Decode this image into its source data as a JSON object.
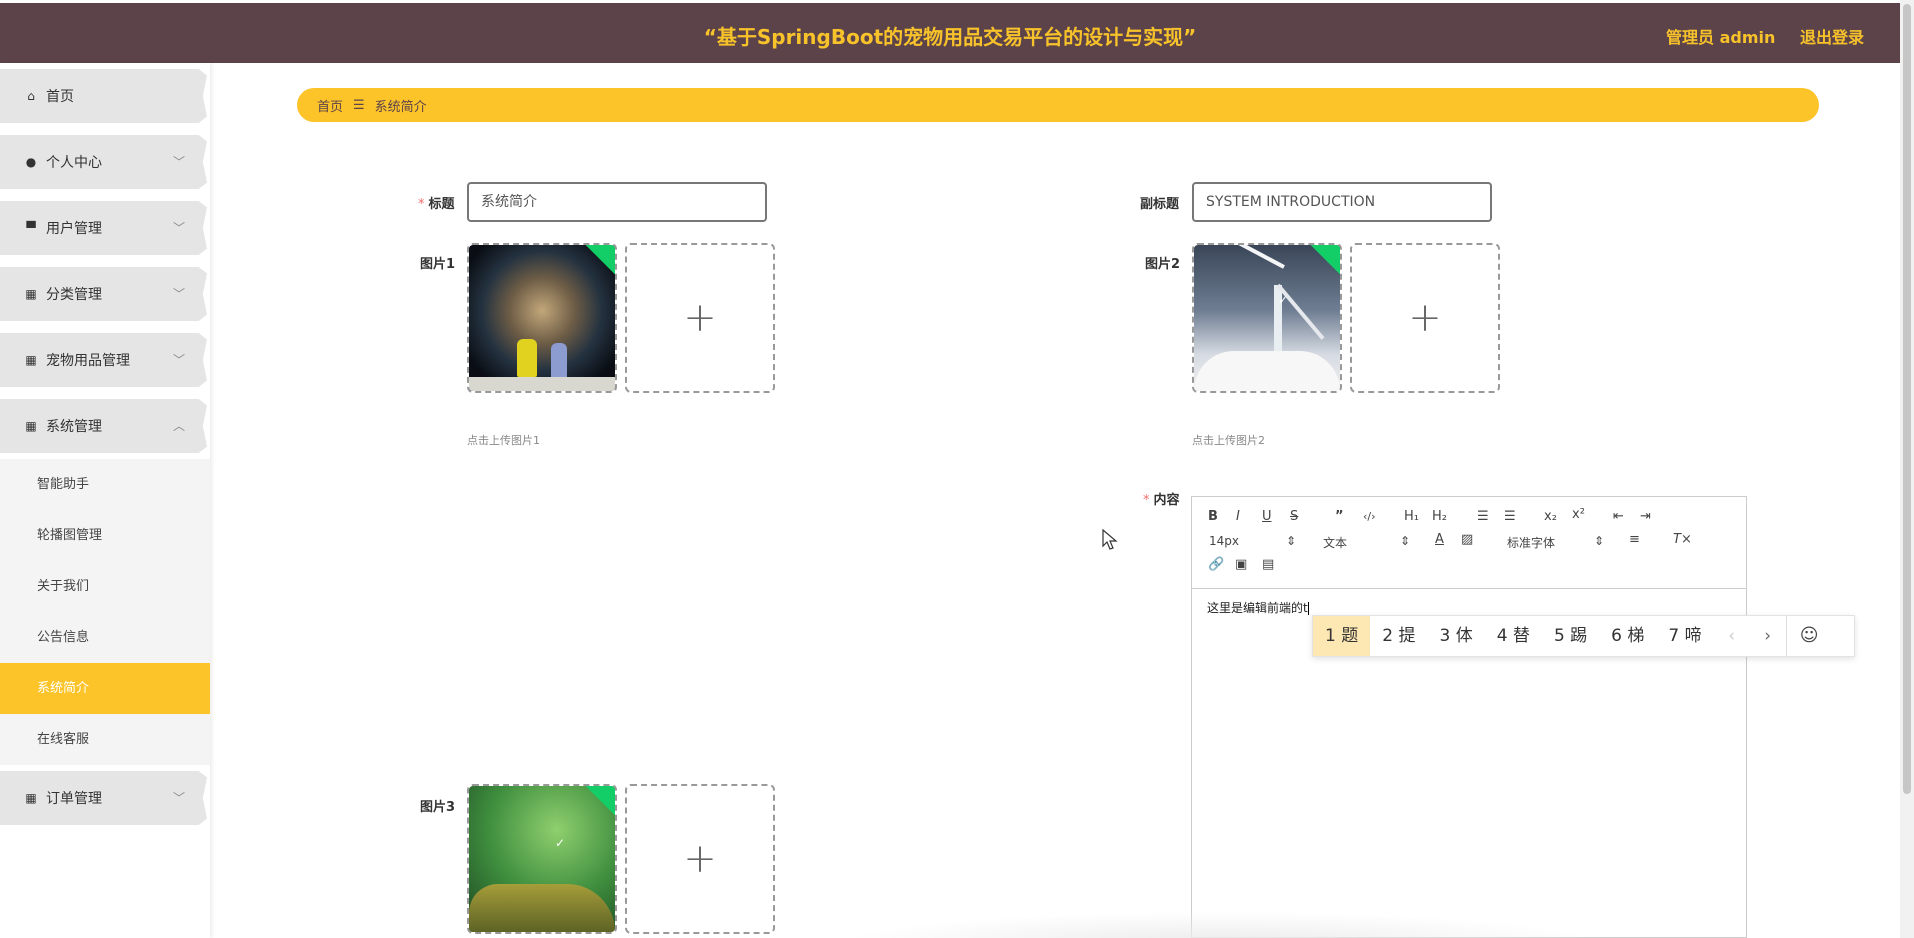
{
  "header": {
    "title": "“基于SpringBoot的宠物用品交易平台的设计与实现”",
    "user": "管理员 admin",
    "logout": "退出登录"
  },
  "sidebar": {
    "items": [
      {
        "label": "首页",
        "icon": "home-icon"
      },
      {
        "label": "个人中心",
        "icon": "user-icon"
      },
      {
        "label": "用户管理",
        "icon": "pin-icon"
      },
      {
        "label": "分类管理",
        "icon": "grid-icon"
      },
      {
        "label": "宠物用品管理",
        "icon": "grid-icon"
      },
      {
        "label": "系统管理",
        "icon": "grid-icon"
      },
      {
        "label": "订单管理",
        "icon": "grid-icon"
      }
    ],
    "submenu": [
      "智能助手",
      "轮播图管理",
      "关于我们",
      "公告信息",
      "系统简介",
      "在线客服"
    ]
  },
  "breadcrumb": {
    "home": "首页",
    "separator": "☰",
    "current": "系统简介"
  },
  "form": {
    "title_label": "标题",
    "title_value": "系统简介",
    "subtitle_label": "副标题",
    "subtitle_value": "SYSTEM INTRODUCTION",
    "pic1_label": "图片1",
    "pic1_hint": "点击上传图片1",
    "pic2_label": "图片2",
    "pic2_hint": "点击上传图片2",
    "pic3_label": "图片3",
    "content_label": "内容",
    "required_mark": "*",
    "plus": "+"
  },
  "editor": {
    "font_size": "14px",
    "paragraph": "文本",
    "font_family": "标准字体",
    "content": "这里是编辑前端的t"
  },
  "ime": {
    "candidates": [
      "1 题",
      "2 提",
      "3 体",
      "4 替",
      "5 踢",
      "6 梯",
      "7 啼"
    ],
    "prev": "‹",
    "next": "›",
    "emoji": "☺"
  },
  "colors": {
    "header_bg": "#5c434a",
    "accent": "#fcc429",
    "title_text": "#f7c22a",
    "badge": "#13ce66"
  }
}
